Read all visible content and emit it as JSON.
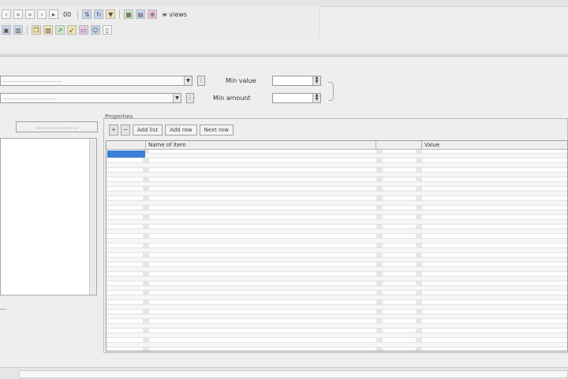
{
  "toolbar": {
    "nav_text": "00",
    "view_text": "≡ views",
    "row1_icons": [
      "prev-icon",
      "back-icon",
      "forward-icon",
      "next-icon",
      "last-icon",
      "sort-icon",
      "refresh-icon",
      "filter-icon",
      "pin-icon",
      "grid-icon",
      "chart-icon",
      "zoom-icon"
    ],
    "row2_icons": [
      "save-icon",
      "print-icon",
      "copy-icon",
      "paste-icon",
      "export-icon",
      "import-icon",
      "folder-icon",
      "user-icon",
      "doc-icon"
    ]
  },
  "filters": {
    "combo1": "..................................",
    "combo2": "...............................",
    "label_a": "Min value",
    "label_b": "Min amount"
  },
  "left": {
    "button_label": "........................",
    "status": "..."
  },
  "group": {
    "title": "Properties",
    "tabs": [
      "Add list",
      "Add row",
      "Next row"
    ]
  },
  "grid": {
    "columns": [
      "",
      "Name of item",
      "",
      "Value"
    ]
  }
}
